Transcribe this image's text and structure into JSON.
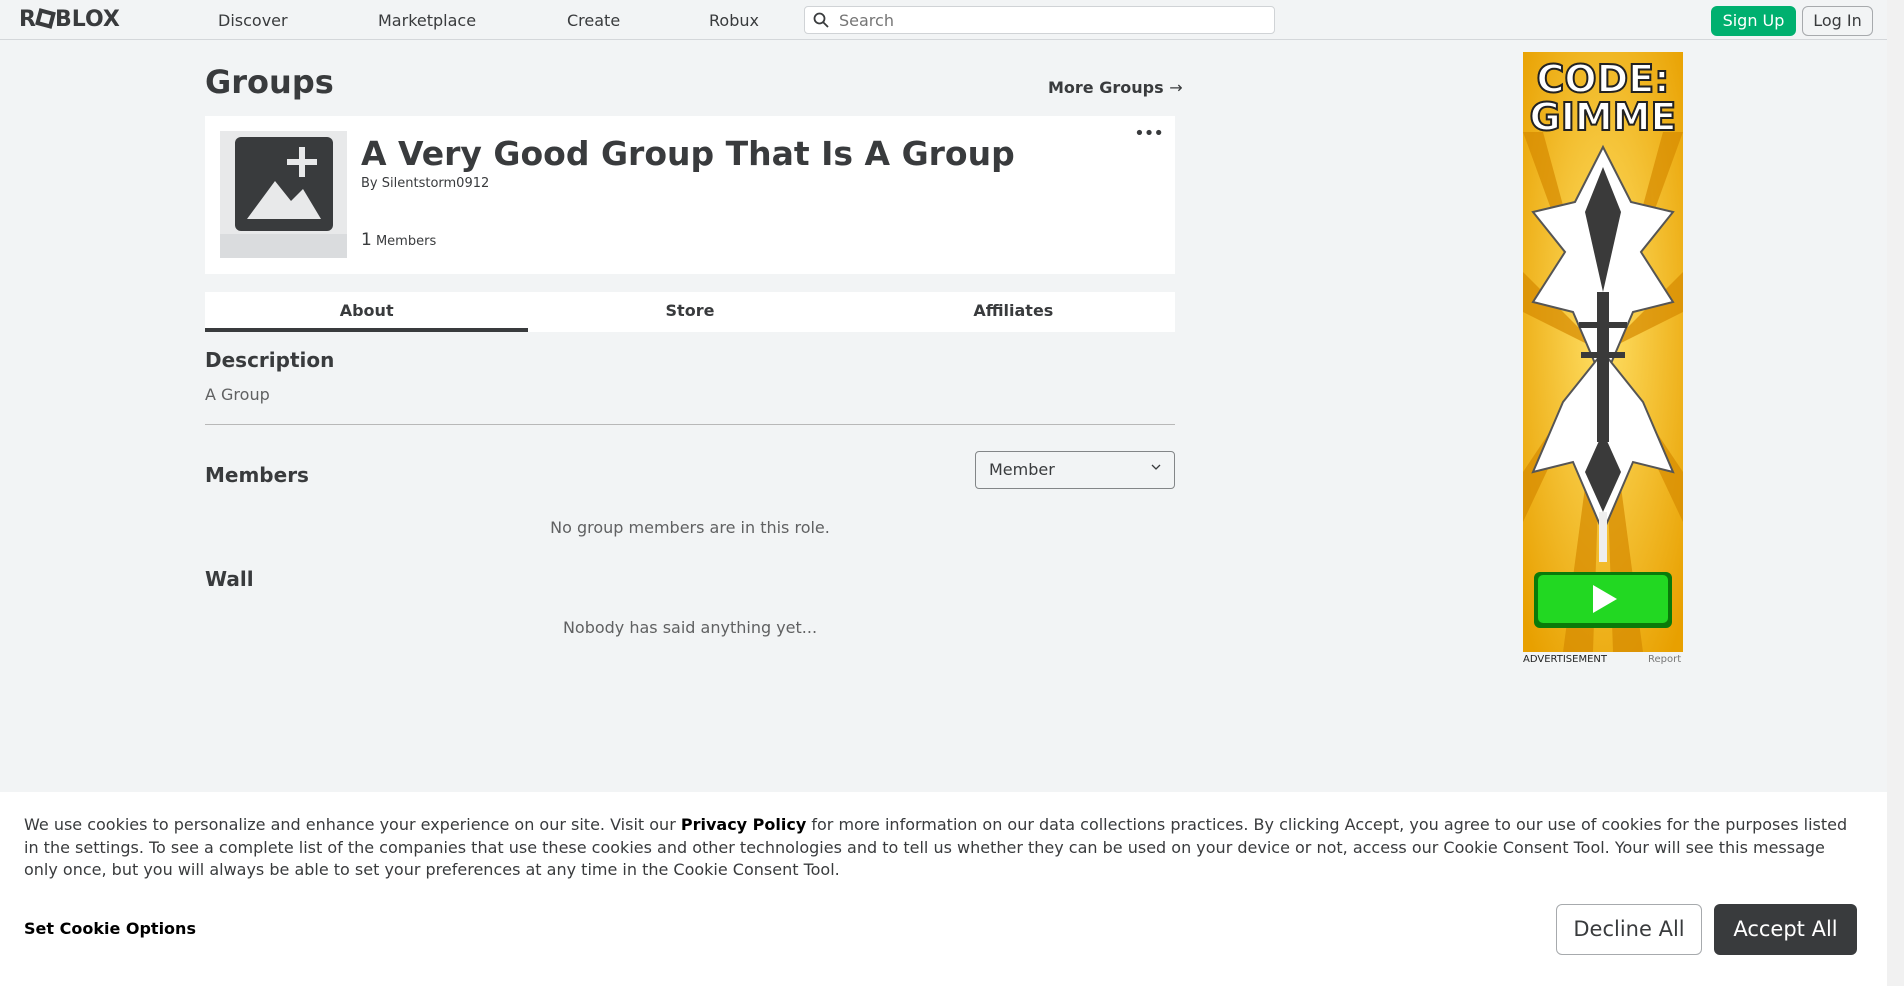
{
  "nav": {
    "logo": "ROBLOX",
    "links": [
      "Discover",
      "Marketplace",
      "Create",
      "Robux"
    ],
    "search_placeholder": "Search",
    "signup_label": "Sign Up",
    "login_label": "Log In"
  },
  "page": {
    "title": "Groups",
    "more_groups": "More Groups",
    "more_groups_arrow": "→"
  },
  "group": {
    "name": "A Very Good Group That Is A Group",
    "by_prefix": "By",
    "owner": "Silentstorm0912",
    "member_count": "1",
    "members_label": "Members",
    "menu_glyph": "•••"
  },
  "tabs": [
    "About",
    "Store",
    "Affiliates"
  ],
  "about": {
    "description_title": "Description",
    "description_text": "A Group",
    "members_title": "Members",
    "role_selected": "Member",
    "members_empty": "No group members are in this role.",
    "wall_title": "Wall",
    "wall_empty": "Nobody has said anything yet..."
  },
  "ad": {
    "headline_line1": "CODE:",
    "headline_line2": "GIMME",
    "label": "ADVERTISEMENT",
    "report": "Report"
  },
  "cookie": {
    "text_part1": "We use cookies to personalize and enhance your experience on our site. Visit our ",
    "privacy_link": "Privacy Policy",
    "text_part2": " for more information on our data collections practices. By clicking Accept, you agree to our use of cookies for the purposes listed in the settings. To see a complete list of the companies that use these cookies and other technologies and to tell us whether they can be used on your device or not, access our Cookie Consent Tool. Your will see this message only once, but you will always be able to set your preferences at any time in the Cookie Consent Tool.",
    "set_options": "Set Cookie Options",
    "decline": "Decline All",
    "accept": "Accept All"
  },
  "colors": {
    "signup_green": "#00b06f",
    "accept_dark": "#393b3d",
    "ad_yellow": "#f4c21a"
  }
}
